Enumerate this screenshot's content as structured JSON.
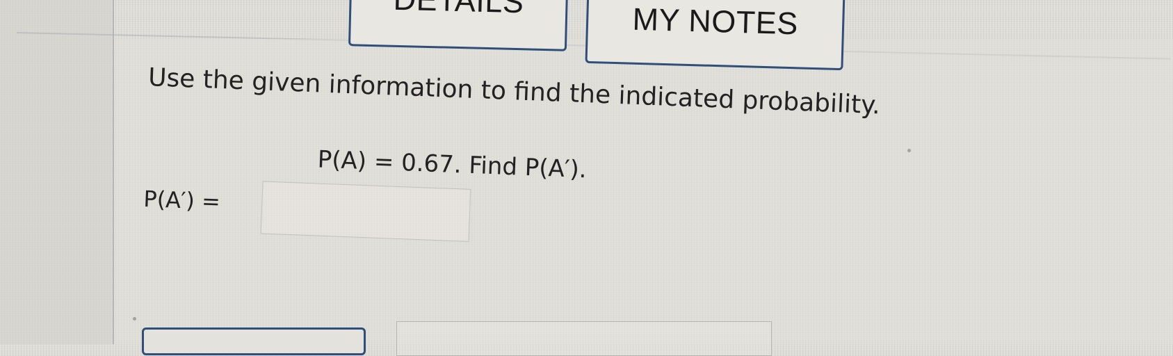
{
  "toolbar": {
    "details_label": "DETAILS",
    "notes_label": "MY NOTES"
  },
  "question": {
    "prompt": "Use the given information to find the indicated probability.",
    "given": "P(A) = 0.67. Find P(A′).",
    "answer_label": "P(A′) =",
    "answer_value": ""
  }
}
